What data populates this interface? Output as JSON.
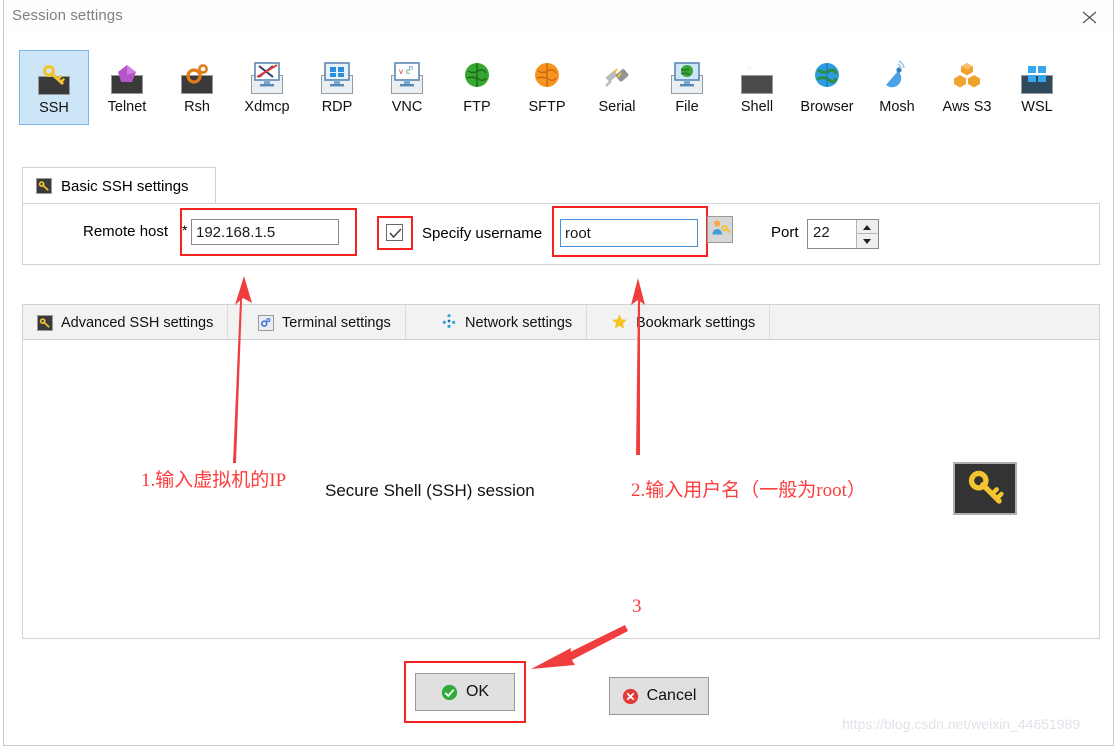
{
  "window": {
    "title": "Session settings",
    "close_icon": "close-icon"
  },
  "session_types": [
    {
      "label": "SSH",
      "icon": "ssh-key-icon",
      "selected": true
    },
    {
      "label": "Telnet",
      "icon": "telnet-icon",
      "selected": false
    },
    {
      "label": "Rsh",
      "icon": "rsh-gears-icon",
      "selected": false
    },
    {
      "label": "Xdmcp",
      "icon": "xdmcp-monitor-icon",
      "selected": false
    },
    {
      "label": "RDP",
      "icon": "rdp-windows-icon",
      "selected": false
    },
    {
      "label": "VNC",
      "icon": "vnc-monitor-icon",
      "selected": false
    },
    {
      "label": "FTP",
      "icon": "ftp-globe-icon",
      "selected": false
    },
    {
      "label": "SFTP",
      "icon": "sftp-globe-icon",
      "selected": false
    },
    {
      "label": "Serial",
      "icon": "serial-plug-icon",
      "selected": false
    },
    {
      "label": "File",
      "icon": "file-monitor-icon",
      "selected": false
    },
    {
      "label": "Shell",
      "icon": "shell-prompt-icon",
      "selected": false
    },
    {
      "label": "Browser",
      "icon": "browser-globe-icon",
      "selected": false
    },
    {
      "label": "Mosh",
      "icon": "mosh-dish-icon",
      "selected": false
    },
    {
      "label": "Aws S3",
      "icon": "aws-s3-icon",
      "selected": false
    },
    {
      "label": "WSL",
      "icon": "wsl-windows-icon",
      "selected": false
    }
  ],
  "basic_settings": {
    "tab_label": "Basic SSH settings",
    "tab_icon": "ssh-key-icon",
    "remote_host_label": "Remote host",
    "required_marker": "*",
    "remote_host_value": "192.168.1.5",
    "specify_username_label": "Specify username",
    "specify_username_checked": true,
    "username_value": "root",
    "username_picker_icon": "user-key-icon",
    "port_label": "Port",
    "port_value": "22"
  },
  "lower_tabs": [
    {
      "label": "Advanced SSH settings",
      "icon": "ssh-key-icon"
    },
    {
      "label": "Terminal settings",
      "icon": "terminal-gear-icon"
    },
    {
      "label": "Network settings",
      "icon": "network-nodes-icon"
    },
    {
      "label": "Bookmark settings",
      "icon": "star-icon"
    }
  ],
  "content": {
    "caption": "Secure Shell (SSH) session",
    "big_icon": "ssh-key-icon"
  },
  "annotations": [
    {
      "id": "anno-1",
      "text": "1.输入虚拟机的IP"
    },
    {
      "id": "anno-2",
      "text": "2.输入用户名（一般为root）"
    },
    {
      "id": "anno-3",
      "text": "3"
    }
  ],
  "buttons": {
    "ok_label": "OK",
    "ok_icon": "check-circle-icon",
    "cancel_label": "Cancel",
    "cancel_icon": "x-circle-icon"
  },
  "watermark": "https://blog.csdn.net/weixin_44651989",
  "colors": {
    "annotation_red": "#fd3c3c",
    "highlight_red": "#f5221f",
    "selected_tile": "#cde6f7",
    "focus_blue": "#4a90d9"
  }
}
